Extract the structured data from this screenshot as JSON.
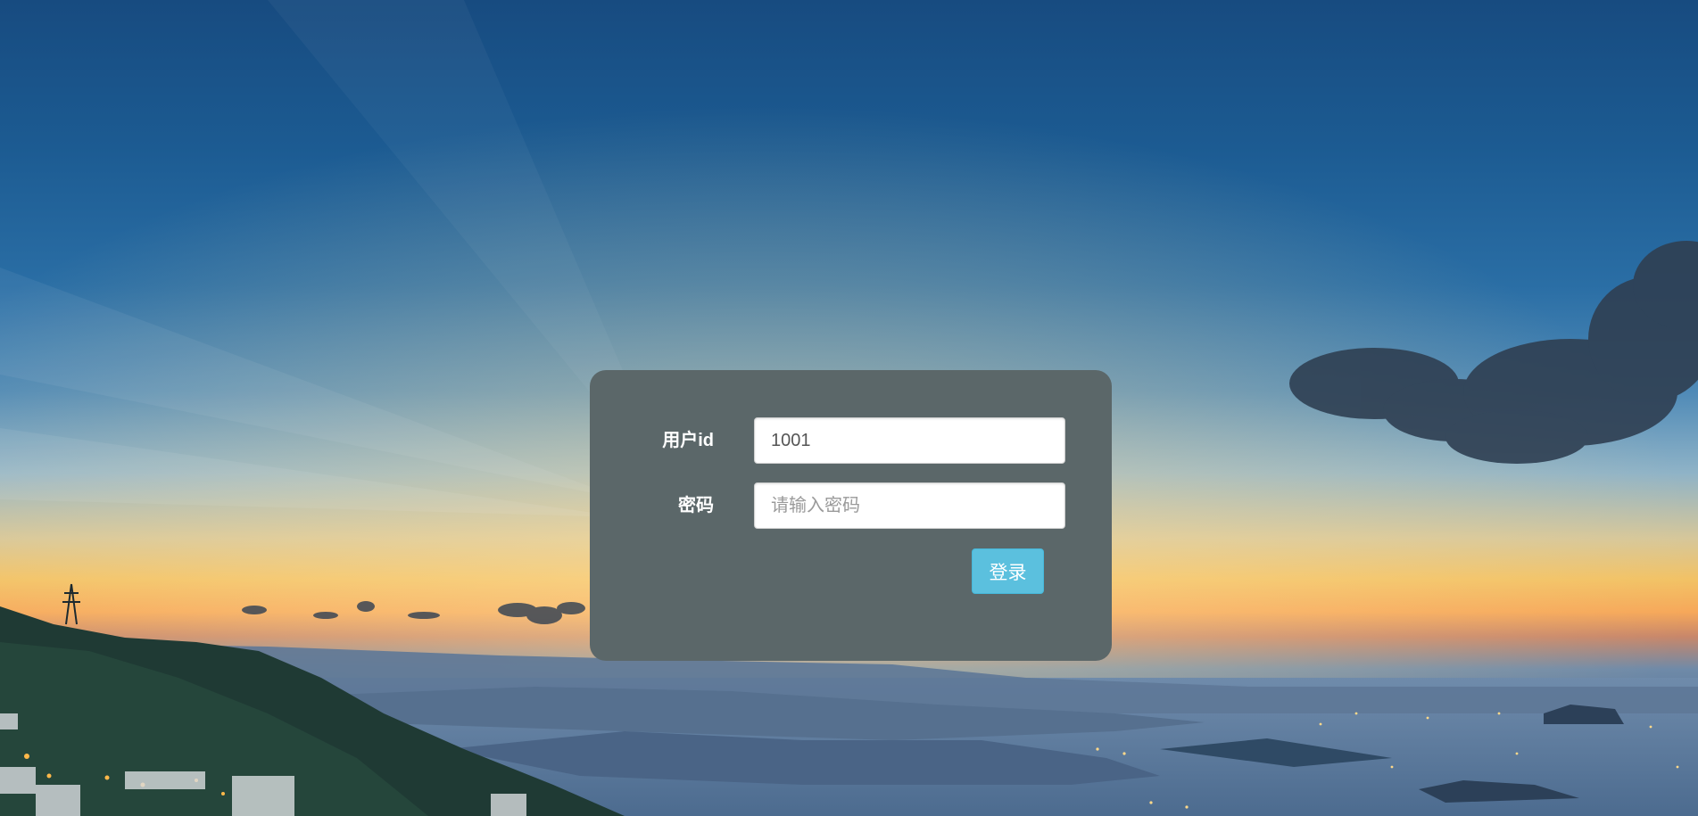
{
  "login_form": {
    "user_id_label": "用户id",
    "user_id_value": "1001",
    "password_label": "密码",
    "password_placeholder": "请输入密码",
    "password_value": "",
    "submit_label": "登录"
  },
  "colors": {
    "panel_background": "#5b6769",
    "button_background": "#5bc0de",
    "label_text": "#ffffff"
  }
}
